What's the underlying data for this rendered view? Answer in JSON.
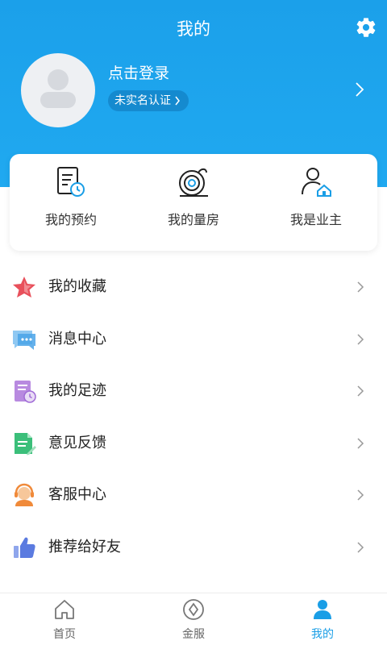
{
  "header": {
    "title": "我的",
    "settings_icon": "gear-icon"
  },
  "profile": {
    "login_text": "点击登录",
    "verify_text": "未实名认证"
  },
  "quick_actions": [
    {
      "label": "我的预约",
      "icon": "appointment-icon"
    },
    {
      "label": "我的量房",
      "icon": "tape-measure-icon"
    },
    {
      "label": "我是业主",
      "icon": "homeowner-icon"
    }
  ],
  "menu": [
    {
      "label": "我的收藏",
      "icon": "star-icon",
      "color": "#e8505b"
    },
    {
      "label": "消息中心",
      "icon": "message-icon",
      "color": "#4aa3e8"
    },
    {
      "label": "我的足迹",
      "icon": "footprint-icon",
      "color": "#a06bd6"
    },
    {
      "label": "意见反馈",
      "icon": "feedback-icon",
      "color": "#3bbf7a"
    },
    {
      "label": "客服中心",
      "icon": "customer-service-icon",
      "color": "#f08a3a"
    },
    {
      "label": "推荐给好友",
      "icon": "thumbs-up-icon",
      "color": "#5b7be0"
    }
  ],
  "tabbar": [
    {
      "label": "首页",
      "icon": "home-icon",
      "active": false
    },
    {
      "label": "金服",
      "icon": "finance-icon",
      "active": false
    },
    {
      "label": "我的",
      "icon": "user-icon",
      "active": true
    }
  ],
  "colors": {
    "header_blue": "#1ba0ea",
    "active_tab": "#1a9ee6"
  }
}
